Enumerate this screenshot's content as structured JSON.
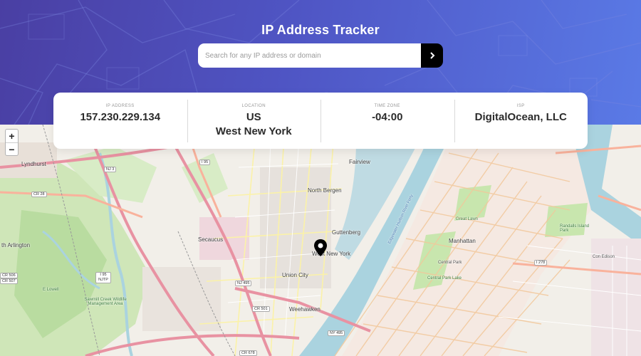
{
  "header": {
    "title": "IP Address Tracker"
  },
  "search": {
    "placeholder": "Search for any IP address or domain",
    "value": "",
    "button_icon": "chevron-right-icon"
  },
  "info": {
    "ip": {
      "label": "IP ADDRESS",
      "value": "157.230.229.134"
    },
    "location": {
      "label": "LOCATION",
      "value_line1": "US",
      "value_line2": "West New York"
    },
    "timezone": {
      "label": "TIME ZONE",
      "value": "-04:00"
    },
    "isp": {
      "label": "ISP",
      "value": "DigitalOcean, LLC"
    }
  },
  "map": {
    "zoom_in": "+",
    "zoom_out": "−",
    "marker_icon": "location-pin-icon",
    "places": {
      "lyndhurst": "Lyndhurst",
      "fairview": "Fairview",
      "north_bergen": "North Bergen",
      "secaucus": "Secaucus",
      "guttenberg": "Guttenberg",
      "west_new_york": "West New York",
      "union_city": "Union City",
      "weehawken": "Weehawken",
      "manhattan": "Manhattan",
      "north_arlington": "th Arlington",
      "central_park": "Central Park",
      "con_edison": "Con Edison"
    },
    "greens": {
      "sawmill": "Sawmill Creek Wildlife Management Area",
      "e_lowell": "E Lowell",
      "great_lawn": "Great Lawn",
      "randalls": "Randalls Island Park",
      "central_lake": "Central Park Lake"
    },
    "water": {
      "hudson": "Edgewater Hudson River Ferry"
    },
    "shields": {
      "nj3": "NJ 3",
      "i95_top": "I 95",
      "cr28": "CR 28",
      "nj495": "NJ 495",
      "i95_njtp": "I 95 NJTP",
      "cr501": "CR 501",
      "ny495": "NY 495",
      "i278": "I 278",
      "cr506": "CR 506",
      "cr507": "CR 507",
      "cr678": "CR 678"
    }
  }
}
